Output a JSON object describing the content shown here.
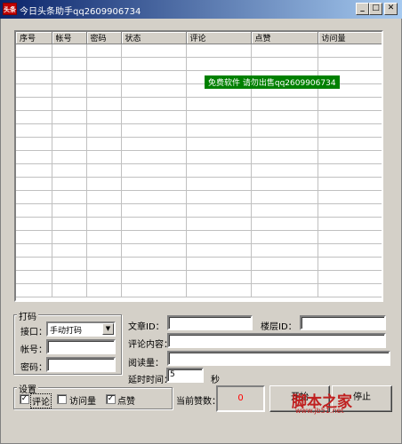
{
  "window": {
    "title": "今日头条助手qq2609906734",
    "icon_text": "头条",
    "icon_color": "#c00000",
    "buttons": [
      "minimize",
      "maximize",
      "close"
    ]
  },
  "table": {
    "columns": [
      "序号",
      "帐号",
      "密码",
      "状态",
      "评论",
      "点赞",
      "访问量"
    ],
    "row_count": 19
  },
  "banner": {
    "text": "免费软件 请勿出售qq2609906734",
    "color": "#008000"
  },
  "captcha": {
    "label": "打码",
    "port_label": "接口：",
    "port_value": "手动打码",
    "account_label": "帐号：",
    "account_value": "",
    "password_label": "密码：",
    "password_value": ""
  },
  "form": {
    "article_id_label": "文章ID：",
    "article_id_value": "",
    "floor_id_label": "楼层ID：",
    "floor_id_value": "",
    "comment_label": "评论内容：",
    "comment_value": "",
    "read_label": "阅读量：",
    "read_value": "",
    "delay_label": "延时时间：",
    "delay_value": "5",
    "delay_unit": "秒"
  },
  "settings": {
    "label": "设置",
    "items": [
      {
        "label": "评论",
        "checked": true
      },
      {
        "label": "访问量",
        "checked": false
      },
      {
        "label": "点赞",
        "checked": true
      }
    ]
  },
  "status": {
    "likes_label": "当前赞数：",
    "likes_value": "0",
    "likes_color": "#ff0000"
  },
  "actions": {
    "start_label": "开始",
    "stop_label": "停止"
  },
  "watermark": {
    "text": "脚本之家",
    "url": "www.jb51.net"
  }
}
